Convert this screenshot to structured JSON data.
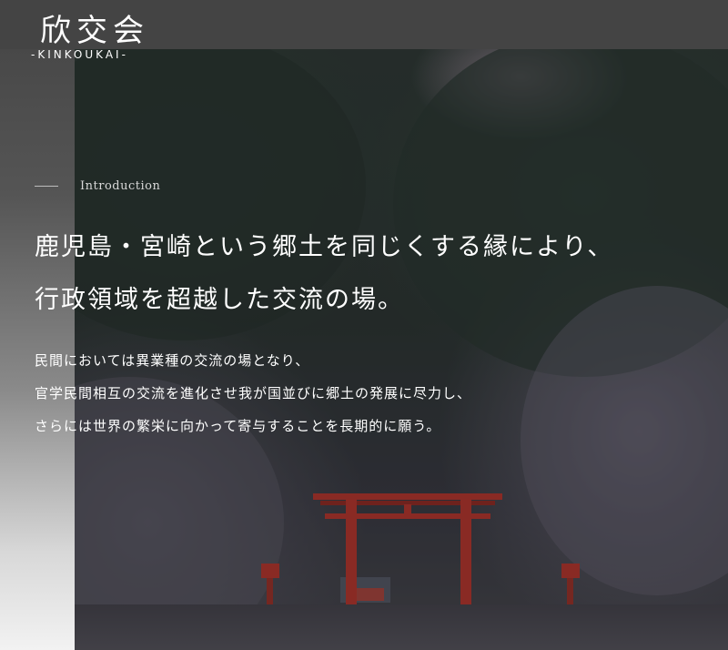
{
  "logo": {
    "kanji": "欣交会",
    "romaji": "-KINKOUKAI-"
  },
  "intro": {
    "label": "Introduction"
  },
  "headline": {
    "lines": [
      "鹿児島・宮崎という郷土を同じくする縁により、",
      "行政領域を超越した交流の場。"
    ]
  },
  "body": {
    "lines": [
      "民間においては異業種の交流の場となり、",
      "官学民間相互の交流を進化させ我が国並びに郷土の発展に尽力し、",
      "さらには世界の繁栄に向かって寄与することを長期的に願う。"
    ]
  },
  "colors": {
    "torii": "#c8372a",
    "text": "#ffffff"
  }
}
